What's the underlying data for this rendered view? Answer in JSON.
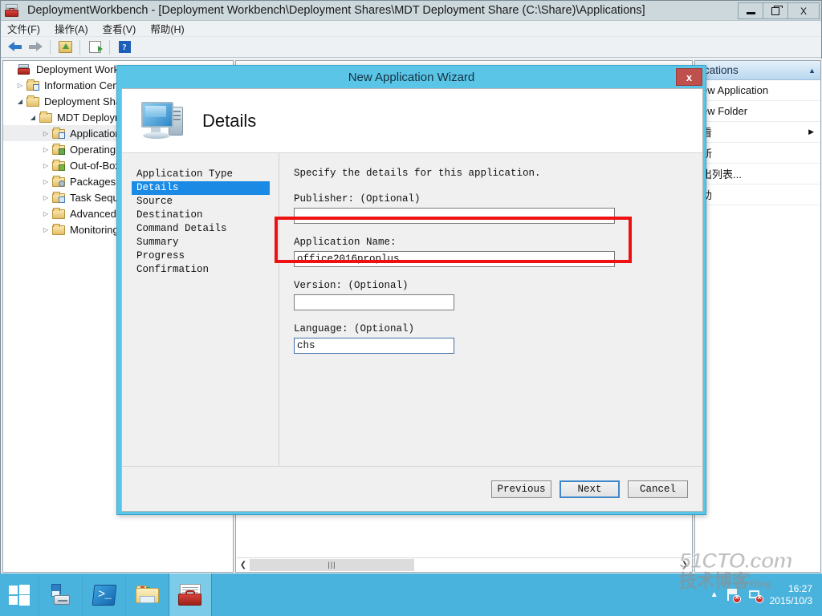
{
  "window": {
    "title": "DeploymentWorkbench - [Deployment Workbench\\Deployment Shares\\MDT Deployment Share (C:\\Share)\\Applications]",
    "icon": "toolbox-icon",
    "buttons": {
      "minimize": "–",
      "maximize": "❐",
      "close": "X"
    }
  },
  "menubar": {
    "items": [
      {
        "label": "文件(F)"
      },
      {
        "label": "操作(A)"
      },
      {
        "label": "查看(V)"
      },
      {
        "label": "帮助(H)"
      }
    ]
  },
  "toolbar": {
    "items": [
      {
        "name": "back-icon",
        "tooltip": "Back"
      },
      {
        "name": "forward-icon",
        "tooltip": "Forward"
      },
      {
        "name": "up-folder-icon",
        "tooltip": "Up one level"
      },
      {
        "name": "export-list-icon",
        "tooltip": "Export List"
      },
      {
        "name": "help-icon",
        "tooltip": "Help"
      }
    ]
  },
  "tree": {
    "nodes": [
      {
        "label": "Deployment Workbench",
        "twisty": "",
        "icon": "workbench-icon",
        "indent": 0,
        "selected": false
      },
      {
        "label": "Information Center",
        "twisty": "▷",
        "icon": "folder-info-icon",
        "indent": 1,
        "selected": false
      },
      {
        "label": "Deployment Shares",
        "twisty": "◢",
        "icon": "folder-icon",
        "indent": 1,
        "selected": false
      },
      {
        "label": "MDT Deployment Share (C",
        "twisty": "◢",
        "icon": "folder-icon",
        "indent": 2,
        "selected": false
      },
      {
        "label": "Applications",
        "twisty": "▷",
        "icon": "folder-app-icon",
        "indent": 3,
        "selected": true
      },
      {
        "label": "Operating Systems",
        "twisty": "▷",
        "icon": "folder-os-icon",
        "indent": 3,
        "selected": false
      },
      {
        "label": "Out-of-Box Drivers",
        "twisty": "▷",
        "icon": "folder-driver-icon",
        "indent": 3,
        "selected": false
      },
      {
        "label": "Packages",
        "twisty": "▷",
        "icon": "folder-package-icon",
        "indent": 3,
        "selected": false
      },
      {
        "label": "Task Sequences",
        "twisty": "▷",
        "icon": "folder-tasksequence-icon",
        "indent": 3,
        "selected": false
      },
      {
        "label": "Advanced Configuration",
        "twisty": "▷",
        "icon": "folder-icon",
        "indent": 3,
        "selected": false
      },
      {
        "label": "Monitoring",
        "twisty": "▷",
        "icon": "folder-icon",
        "indent": 3,
        "selected": false
      }
    ]
  },
  "listview": {
    "hscroll_thumb_glyph": "|||",
    "scroll_left_glyph": "❮",
    "scroll_right_glyph": "❯"
  },
  "actions": {
    "header": "ications",
    "caret": "▲",
    "items": [
      {
        "label": "ew Application",
        "submenu": ""
      },
      {
        "label": "ew Folder",
        "submenu": ""
      },
      {
        "label": "看",
        "submenu": "▶"
      },
      {
        "label": "新",
        "submenu": ""
      },
      {
        "label": "出列表...",
        "submenu": ""
      },
      {
        "label": "助",
        "submenu": ""
      }
    ]
  },
  "wizard": {
    "title": "New Application Wizard",
    "close_label": "x",
    "heading": "Details",
    "banner_icon": "computer-icon",
    "steps": [
      {
        "label": "Application Type",
        "active": false
      },
      {
        "label": "Details",
        "active": true
      },
      {
        "label": "Source",
        "active": false
      },
      {
        "label": "Destination",
        "active": false
      },
      {
        "label": "Command Details",
        "active": false
      },
      {
        "label": "Summary",
        "active": false
      },
      {
        "label": "Progress",
        "active": false
      },
      {
        "label": "Confirmation",
        "active": false
      }
    ],
    "intro": "Specify the details for this application.",
    "fields": {
      "publisher": {
        "label": "Publisher: (Optional)",
        "value": "",
        "placeholder": ""
      },
      "application_name": {
        "label": "Application Name:",
        "value": "office2016proplus",
        "placeholder": ""
      },
      "version": {
        "label": "Version: (Optional)",
        "value": "",
        "placeholder": ""
      },
      "language": {
        "label": "Language: (Optional)",
        "value": "chs",
        "placeholder": ""
      }
    },
    "buttons": {
      "previous": "Previous",
      "next": "Next",
      "cancel": "Cancel"
    },
    "highlight_color": "#ee1111",
    "titlebar_color": "#5bc5e8",
    "accent_color": "#1a8ae5"
  },
  "taskbar": {
    "start_label": "Start",
    "items": [
      {
        "name": "server-manager",
        "active": false
      },
      {
        "name": "powershell",
        "active": false
      },
      {
        "name": "file-explorer",
        "active": false
      },
      {
        "name": "deployment-workbench",
        "active": true
      }
    ],
    "tray": {
      "caret": "▲",
      "icons": [
        "action-center-flag-icon",
        "network-icon"
      ],
      "time": "16:27",
      "date": "2015/10/3"
    }
  },
  "watermark": {
    "line1": "51CTO.com",
    "line2": "技术博客",
    "line3": "Blog"
  }
}
